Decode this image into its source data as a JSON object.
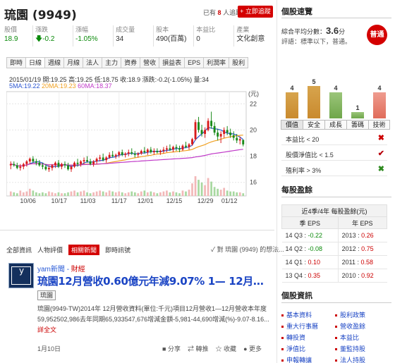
{
  "header": {
    "stock_name": "琉園 (9949)",
    "tracking_pre": "已有",
    "tracking_count": "8",
    "tracking_post": "人追蹤",
    "follow_button": "+ 立即追蹤"
  },
  "quote": {
    "headers": [
      "股價",
      "漲跌",
      "漲幅",
      "成交量",
      "股本",
      "本益比",
      "產業"
    ],
    "values": [
      "18.9",
      "-0.2",
      "-1.05%",
      "34",
      "490(百萬)",
      "0",
      "文化創意"
    ]
  },
  "chart_tabs": [
    "即時",
    "日線",
    "週線",
    "月線",
    "法人",
    "主力",
    "資券",
    "營收",
    "損益表",
    "EPS",
    "利潤率",
    "股利"
  ],
  "chart_tabs_active": "日線",
  "chart_info": {
    "line1": "2015/01/19 開:19.25 高:19.25 低:18.75 收:18.9 漲跌:-0.2(-1.05%) 量:34",
    "line2_5ma": "5MA:19.22",
    "line2_20ma": "20MA:19.23",
    "line2_60ma": "60MA:18.37",
    "unit": "(元)"
  },
  "chart_data": {
    "type": "candlestick",
    "x_ticks": [
      "10/06",
      "10/17",
      "11/03",
      "11/17",
      "12/01",
      "12/15",
      "12/29",
      "01/12"
    ],
    "y_ticks": [
      "22",
      "20",
      "18",
      "16"
    ],
    "ylim": [
      15.5,
      22.5
    ],
    "series": [
      {
        "name": "5MA",
        "color": "#2b56d1"
      },
      {
        "name": "20MA",
        "color": "#f0a020"
      },
      {
        "name": "60MA",
        "color": "#c03ac8"
      }
    ],
    "candles": [
      [
        17.3,
        17.6,
        17.0,
        17.4,
        5
      ],
      [
        17.4,
        17.6,
        17.2,
        17.3,
        4
      ],
      [
        17.3,
        17.5,
        17.0,
        17.1,
        3
      ],
      [
        17.1,
        17.4,
        16.9,
        17.2,
        6
      ],
      [
        17.2,
        17.5,
        17.0,
        17.4,
        4
      ],
      [
        17.4,
        17.7,
        17.2,
        17.6,
        5
      ],
      [
        17.6,
        17.9,
        17.4,
        17.8,
        8
      ],
      [
        17.8,
        18.0,
        17.5,
        17.6,
        6
      ],
      [
        17.6,
        17.8,
        17.3,
        17.5,
        4
      ],
      [
        17.5,
        17.7,
        17.2,
        17.3,
        3
      ],
      [
        17.3,
        17.5,
        17.0,
        17.2,
        4
      ],
      [
        17.2,
        17.4,
        16.9,
        17.0,
        3
      ],
      [
        17.0,
        17.3,
        16.8,
        17.1,
        5
      ],
      [
        17.1,
        17.4,
        16.9,
        17.3,
        4
      ],
      [
        17.3,
        17.6,
        17.1,
        17.5,
        3
      ],
      [
        17.5,
        17.7,
        17.1,
        17.2,
        4
      ],
      [
        17.2,
        17.5,
        17.0,
        17.4,
        3
      ],
      [
        17.4,
        17.6,
        17.1,
        17.3,
        3
      ],
      [
        17.3,
        17.5,
        16.9,
        17.0,
        4
      ],
      [
        17.0,
        17.3,
        16.8,
        17.2,
        5
      ],
      [
        17.2,
        17.6,
        17.1,
        17.5,
        6
      ],
      [
        17.5,
        17.8,
        17.2,
        17.4,
        4
      ],
      [
        17.4,
        17.7,
        17.2,
        17.6,
        5
      ],
      [
        17.6,
        17.9,
        17.4,
        17.7,
        6
      ],
      [
        17.7,
        18.0,
        17.5,
        17.6,
        4
      ],
      [
        17.6,
        17.8,
        17.3,
        17.4,
        3
      ],
      [
        17.4,
        17.7,
        17.2,
        17.6,
        4
      ],
      [
        17.6,
        17.9,
        17.4,
        17.8,
        5
      ],
      [
        17.8,
        18.1,
        17.6,
        17.9,
        6
      ],
      [
        17.9,
        18.2,
        17.6,
        17.7,
        5
      ],
      [
        17.7,
        18.0,
        17.5,
        17.9,
        4
      ],
      [
        17.9,
        18.3,
        17.8,
        18.1,
        6
      ],
      [
        18.1,
        18.4,
        17.9,
        18.0,
        5
      ],
      [
        18.0,
        18.2,
        17.8,
        18.1,
        4
      ],
      [
        18.1,
        18.4,
        17.9,
        18.3,
        5
      ],
      [
        18.3,
        18.5,
        18.0,
        18.1,
        4
      ],
      [
        18.1,
        18.3,
        17.9,
        18.2,
        3
      ],
      [
        18.2,
        18.5,
        18.0,
        18.3,
        4
      ],
      [
        18.3,
        18.6,
        18.1,
        18.2,
        5
      ],
      [
        18.2,
        18.4,
        17.9,
        18.1,
        4
      ],
      [
        18.1,
        18.3,
        17.9,
        18.2,
        3
      ],
      [
        18.2,
        18.5,
        18.1,
        18.4,
        5
      ],
      [
        18.4,
        18.7,
        18.2,
        18.3,
        6
      ],
      [
        18.3,
        18.6,
        18.1,
        18.5,
        4
      ],
      [
        18.5,
        18.7,
        18.2,
        18.3,
        5
      ],
      [
        18.3,
        18.6,
        18.1,
        18.4,
        4
      ],
      [
        18.4,
        18.6,
        18.2,
        18.3,
        3
      ],
      [
        18.3,
        18.5,
        18.1,
        18.4,
        4
      ],
      [
        18.4,
        18.7,
        18.2,
        18.5,
        5
      ],
      [
        18.5,
        18.8,
        18.3,
        18.6,
        6
      ],
      [
        18.6,
        18.9,
        18.4,
        18.5,
        4
      ],
      [
        18.5,
        18.8,
        18.3,
        18.7,
        5
      ],
      [
        18.7,
        18.9,
        18.4,
        18.6,
        4
      ],
      [
        18.6,
        18.8,
        18.3,
        18.5,
        3
      ],
      [
        18.5,
        18.9,
        18.4,
        18.8,
        6
      ],
      [
        18.8,
        19.1,
        18.6,
        18.7,
        5
      ],
      [
        18.7,
        19.0,
        18.5,
        18.9,
        7
      ],
      [
        18.9,
        19.4,
        18.8,
        19.3,
        14
      ],
      [
        19.3,
        20.8,
        19.2,
        20.6,
        22
      ],
      [
        20.6,
        21.0,
        19.8,
        20.0,
        18
      ],
      [
        20.0,
        20.4,
        19.5,
        19.7,
        15
      ],
      [
        19.7,
        20.2,
        19.4,
        20.0,
        12
      ],
      [
        20.0,
        20.9,
        19.9,
        20.7,
        20
      ],
      [
        20.7,
        21.4,
        20.1,
        20.3,
        16
      ],
      [
        20.3,
        20.6,
        19.6,
        19.8,
        10
      ],
      [
        19.8,
        20.1,
        19.2,
        19.5,
        8
      ],
      [
        19.5,
        19.9,
        19.0,
        19.7,
        7
      ],
      [
        19.7,
        20.2,
        19.4,
        20.0,
        9
      ],
      [
        20.0,
        20.3,
        19.6,
        19.8,
        6
      ],
      [
        19.8,
        20.1,
        19.4,
        19.6,
        5
      ],
      [
        19.6,
        19.9,
        19.2,
        19.4,
        5
      ],
      [
        19.4,
        19.7,
        19.0,
        19.2,
        4
      ],
      [
        19.2,
        19.5,
        18.9,
        19.3,
        4
      ],
      [
        19.25,
        19.25,
        18.75,
        18.9,
        3
      ]
    ]
  },
  "news": {
    "tabs": [
      "全部資訊",
      "人物評價",
      "相關新聞",
      "即時訊號"
    ],
    "active_tab": "相關新聞",
    "subscribe_text": "對 琉園 (9949) 的想法...",
    "source_name": "yam新聞",
    "source_cat": "財經",
    "headline": "琉園12月營收0.60億元年減9.07% 1— 12月…",
    "tag": "琉園",
    "snippet": "琉園(9949-TW)2014年 12月營收資料(單位:千元)項目12月營收1—12月營收本年度59,952502,986去年同期65,933547,676增減金額-5,981-44,690增減(%)-9.07-8.16...",
    "more_link": "詳全文",
    "date": "1月10日",
    "actions": [
      "分享",
      "轉推",
      "收藏",
      "更多"
    ]
  },
  "overview": {
    "title": "個股速覽",
    "summary_label": "綜合平均分數：",
    "summary_score": "3.6",
    "summary_unit": "分",
    "eval_text": "評語：標準以下，普通。",
    "rating": "普通",
    "bars": [
      {
        "label": "價值",
        "value": 4,
        "color": "orange"
      },
      {
        "label": "安全",
        "value": 5,
        "color": "orange"
      },
      {
        "label": "成長",
        "value": 4,
        "color": "green"
      },
      {
        "label": "籌碼",
        "value": 1,
        "color": "green"
      },
      {
        "label": "技術",
        "value": 4,
        "color": "red"
      }
    ],
    "criteria": [
      {
        "label": "本益比 < 20",
        "mark": "✖",
        "status": "fail"
      },
      {
        "label": "股價淨值比 < 1.5",
        "mark": "✔",
        "status": "pass-red"
      },
      {
        "label": "殖利率 > 3%",
        "mark": "✖",
        "status": "fail-green"
      }
    ]
  },
  "eps": {
    "title": "每股盈餘",
    "caption": "近4季/4年 每股盈餘(元)",
    "col_headers": [
      "季 EPS",
      "年 EPS"
    ],
    "rows": [
      {
        "q": "14 Q3",
        "qv": "-0.22",
        "y": "2013",
        "yv": "0.26"
      },
      {
        "q": "14 Q2",
        "qv": "-0.08",
        "y": "2012",
        "yv": "0.75"
      },
      {
        "q": "14 Q1",
        "qv": "0.10",
        "y": "2011",
        "yv": "0.58"
      },
      {
        "q": "13 Q4",
        "qv": "0.35",
        "y": "2010",
        "yv": "0.92"
      }
    ]
  },
  "stock_info": {
    "title": "個股資訊",
    "items": [
      [
        "基本資料",
        "股利政策"
      ],
      [
        "重大行事曆",
        "營收盈餘"
      ],
      [
        "轉投資",
        "本益比"
      ],
      [
        "淨值比",
        "董監持股"
      ],
      [
        "申報轉讓",
        "法人持股"
      ]
    ]
  }
}
